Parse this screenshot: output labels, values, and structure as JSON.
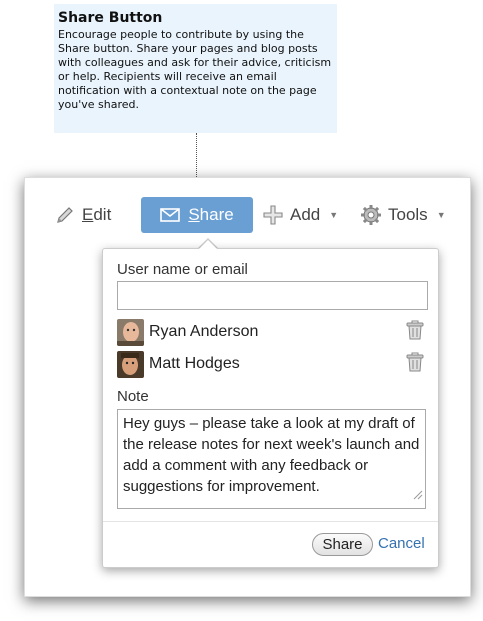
{
  "callout": {
    "title": "Share Button",
    "body": "Encourage people to contribute by using the Share button. Share your pages and blog posts with colleagues and ask for their advice, criticism or help. Recipients will receive an email notification with a contextual note on the page you've shared."
  },
  "toolbar": {
    "edit_label": "Edit",
    "share_label": "Share",
    "add_label": "Add",
    "tools_label": "Tools",
    "share_color": "#6a9fd4"
  },
  "dialog": {
    "user_label": "User name or email",
    "user_input_value": "",
    "recipients": [
      {
        "name": "Ryan Anderson"
      },
      {
        "name": "Matt Hodges"
      }
    ],
    "note_label": "Note",
    "note_text": "Hey guys – please take a look at my draft of the release notes for next week's launch and add a comment with any feedback or suggestions for improvement.",
    "share_button_label": "Share",
    "cancel_label": "Cancel",
    "cancel_color": "#3572b0"
  }
}
